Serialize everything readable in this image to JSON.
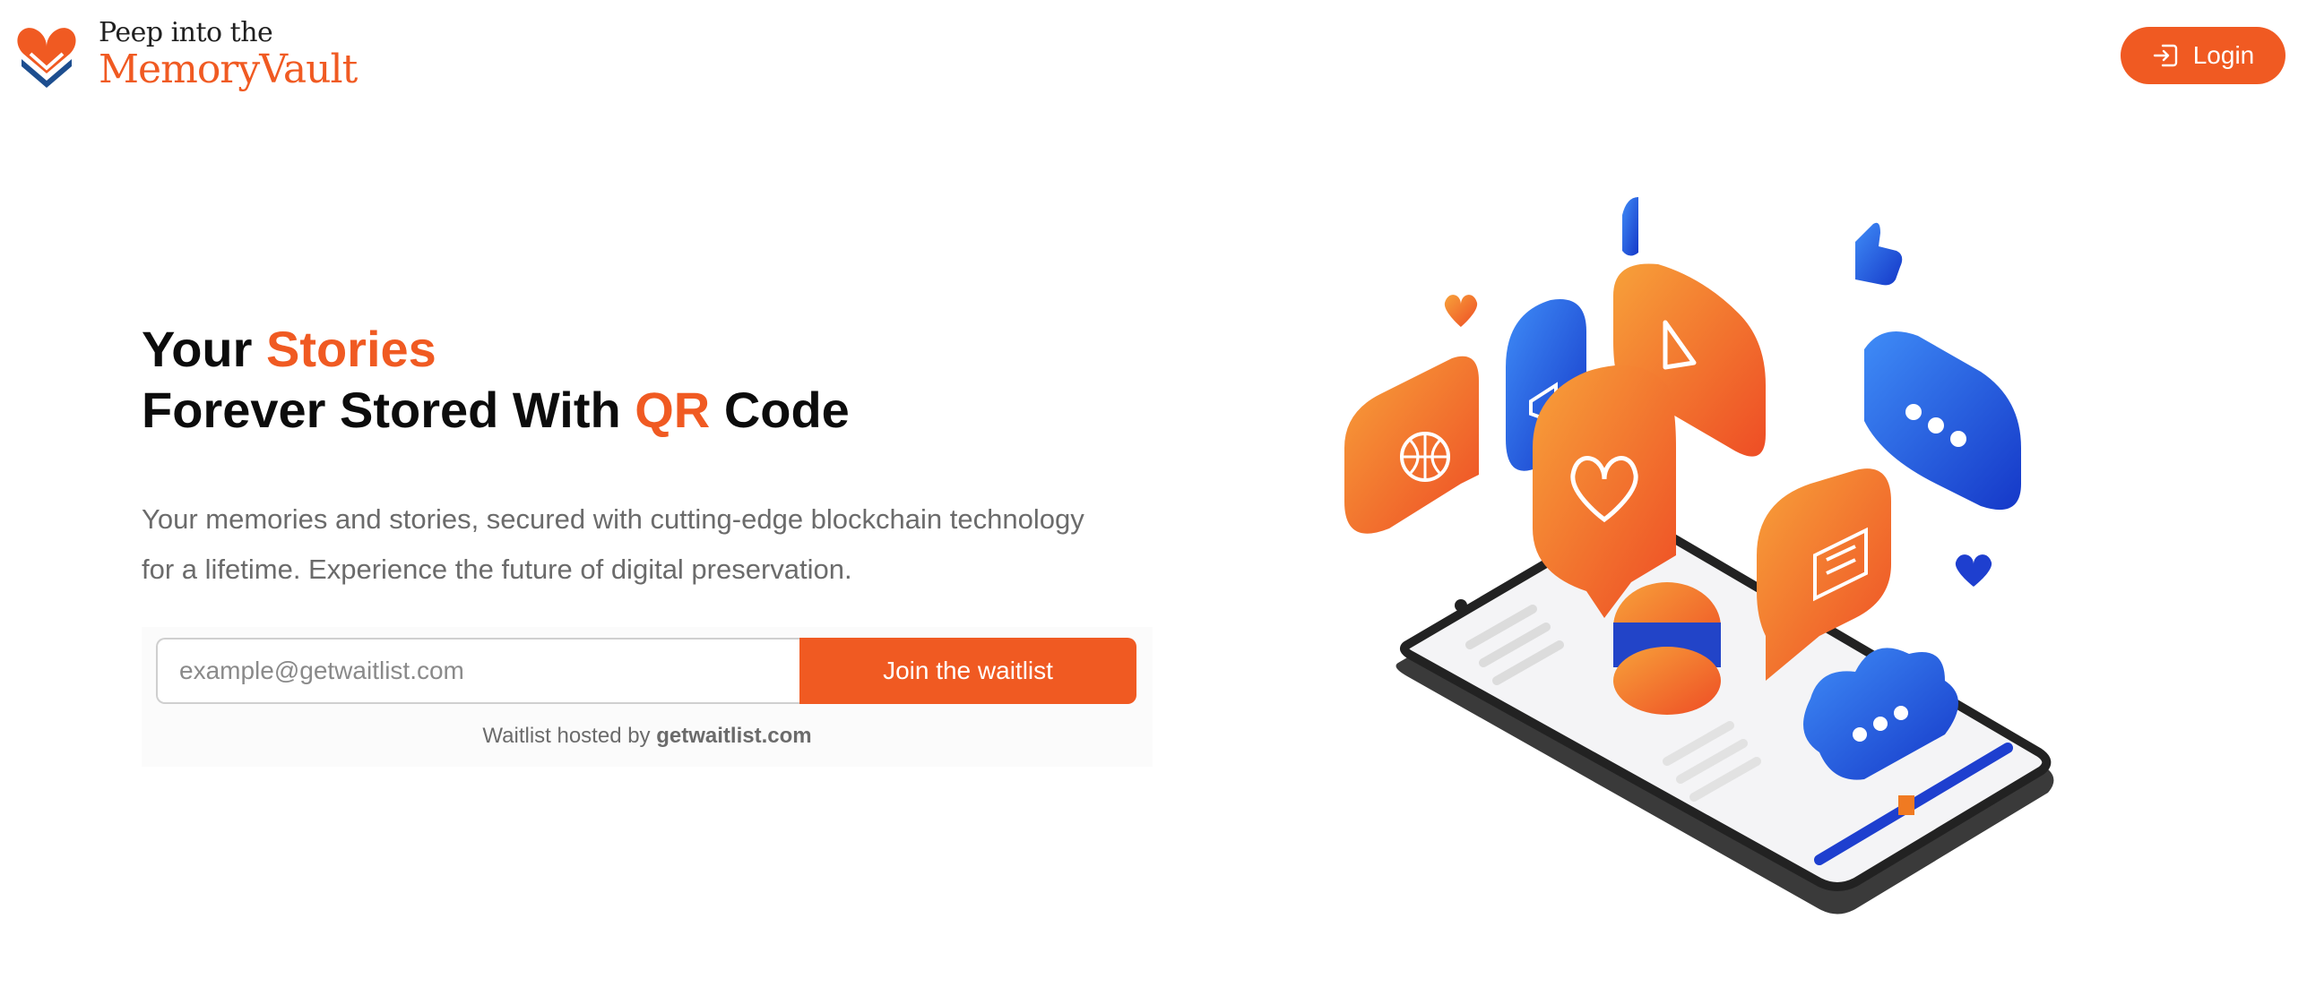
{
  "header": {
    "logo_line1": "Peep into the",
    "logo_line2": "MemoryVault",
    "login_label": "Login",
    "login_icon": "login-icon"
  },
  "hero": {
    "headline_line1_prefix": "Your",
    "headline_line1_accent": "Stories",
    "headline_line2_prefix": "Forever Stored With",
    "headline_line2_accent": "QR",
    "headline_line2_suffix": "Code",
    "subtitle_line1": "Your memories and stories, secured with cutting-edge blockchain technology",
    "subtitle_line2": "for a lifetime. Experience the future of digital preservation."
  },
  "waitlist": {
    "email_placeholder": "example@getwaitlist.com",
    "email_value": "",
    "join_label": "Join the waitlist",
    "hosted_prefix": "Waitlist hosted by",
    "hosted_link": "getwaitlist.com"
  },
  "illustration": {
    "description_icons": [
      "phone-icon",
      "globe-bubble-icon",
      "heart-bubble-icon",
      "megaphone-bubble-icon",
      "play-bubble-icon",
      "chat-dots-bubble-icon",
      "message-bubble-icon",
      "cloud-icon",
      "thumbs-up-icon",
      "heart-icon",
      "burger-icon"
    ]
  },
  "colors": {
    "accent": "#f05a22",
    "blue": "#1e4fe0",
    "text_dark": "#0c0c0c",
    "text_muted": "#6b6b6b"
  }
}
